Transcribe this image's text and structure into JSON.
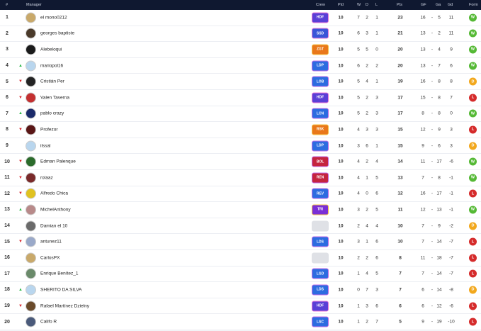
{
  "header": {
    "pos": "#",
    "manager": "Manager",
    "crew": "Crew",
    "pld": "Pld",
    "w": "W",
    "d": "D",
    "l": "L",
    "pts": "Pts",
    "gf": "GF",
    "ga": "Ga",
    "gd": "Gd",
    "form": "Form"
  },
  "colors": {
    "header_bg": "#0f1830",
    "win": "#55b935",
    "draw": "#f2a81d",
    "loss": "#d52b2b",
    "trend_up": "#2db84a",
    "trend_down": "#d8262d"
  },
  "rows": [
    {
      "pos": "1",
      "trend": "",
      "avatar": "#c9a96a",
      "name": "el mono0212",
      "crew": "HDF",
      "crew_color": "#5a3fd6",
      "crew_border": "#e97bd9",
      "pld": "10",
      "w": "7",
      "d": "2",
      "l": "1",
      "pts": "23",
      "gf": "16",
      "ga": "5",
      "gd": "11",
      "form": "W"
    },
    {
      "pos": "2",
      "trend": "",
      "avatar": "#4a3a2a",
      "name": "georges baptiste",
      "crew": "SSD",
      "crew_color": "#3a55d8",
      "crew_border": "#e97bd9",
      "pld": "10",
      "w": "6",
      "d": "3",
      "l": "1",
      "pts": "21",
      "gf": "13",
      "ga": "2",
      "gd": "11",
      "form": "W"
    },
    {
      "pos": "3",
      "trend": "",
      "avatar": "#1b1b1b",
      "name": "Alebeloqui",
      "crew": "ZGT",
      "crew_color": "#e9781a",
      "crew_border": "#f5c34a",
      "pld": "10",
      "w": "5",
      "d": "5",
      "l": "0",
      "pts": "20",
      "gf": "13",
      "ga": "4",
      "gd": "9",
      "form": "W"
    },
    {
      "pos": "4",
      "trend": "up",
      "avatar": "#b9d6ee",
      "name": "mariopol16",
      "crew": "LDP",
      "crew_color": "#2d6ce0",
      "crew_border": "#c26ce9",
      "pld": "10",
      "w": "6",
      "d": "2",
      "l": "2",
      "pts": "20",
      "gf": "13",
      "ga": "7",
      "gd": "6",
      "form": "W"
    },
    {
      "pos": "5",
      "trend": "down",
      "avatar": "#232323",
      "name": "Cristián Per",
      "crew": "LOB",
      "crew_color": "#2d6ce0",
      "crew_border": "#c26ce9",
      "pld": "10",
      "w": "5",
      "d": "4",
      "l": "1",
      "pts": "19",
      "gf": "16",
      "ga": "8",
      "gd": "8",
      "form": "D"
    },
    {
      "pos": "6",
      "trend": "down",
      "avatar": "#c43030",
      "name": "Valen Taverna",
      "crew": "HDF",
      "crew_color": "#5a3fd6",
      "crew_border": "#e97bd9",
      "pld": "10",
      "w": "5",
      "d": "2",
      "l": "3",
      "pts": "17",
      "gf": "15",
      "ga": "8",
      "gd": "7",
      "form": "L"
    },
    {
      "pos": "7",
      "trend": "up",
      "avatar": "#1a2a6a",
      "name": "pablo crazy",
      "crew": "LCN",
      "crew_color": "#2d6ce0",
      "crew_border": "#c26ce9",
      "pld": "10",
      "w": "5",
      "d": "2",
      "l": "3",
      "pts": "17",
      "gf": "8",
      "ga": "8",
      "gd": "0",
      "form": "W"
    },
    {
      "pos": "8",
      "trend": "down",
      "avatar": "#5a1616",
      "name": "Profezor",
      "crew": "RSK",
      "crew_color": "#e9781a",
      "crew_border": "#f5c34a",
      "pld": "10",
      "w": "4",
      "d": "3",
      "l": "3",
      "pts": "15",
      "gf": "12",
      "ga": "9",
      "gd": "3",
      "form": "L"
    },
    {
      "pos": "9",
      "trend": "",
      "avatar": "#b9d6ee",
      "name": "ilssal",
      "crew": "LDP",
      "crew_color": "#2d6ce0",
      "crew_border": "#c26ce9",
      "pld": "10",
      "w": "3",
      "d": "6",
      "l": "1",
      "pts": "15",
      "gf": "9",
      "ga": "6",
      "gd": "3",
      "form": "D"
    },
    {
      "pos": "10",
      "trend": "down",
      "avatar": "#2b6b2b",
      "name": "Edman Palenque",
      "crew": "BOL",
      "crew_color": "#c4243f",
      "crew_border": "#c26ce9",
      "pld": "10",
      "w": "4",
      "d": "2",
      "l": "4",
      "pts": "14",
      "gf": "11",
      "ga": "17",
      "gd": "-6",
      "form": "W"
    },
    {
      "pos": "11",
      "trend": "down",
      "avatar": "#7a2a2a",
      "name": "rolaaz",
      "crew": "REN",
      "crew_color": "#c4243f",
      "crew_border": "#c26ce9",
      "pld": "10",
      "w": "4",
      "d": "1",
      "l": "5",
      "pts": "13",
      "gf": "7",
      "ga": "8",
      "gd": "-1",
      "form": "W"
    },
    {
      "pos": "12",
      "trend": "down",
      "avatar": "#e0c220",
      "name": "Alfredo Chica",
      "crew": "REV",
      "crew_color": "#2d6ce0",
      "crew_border": "#c26ce9",
      "pld": "10",
      "w": "4",
      "d": "0",
      "l": "6",
      "pts": "12",
      "gf": "16",
      "ga": "17",
      "gd": "-1",
      "form": "L"
    },
    {
      "pos": "13",
      "trend": "up",
      "avatar": "#b88a8a",
      "name": "MichelAnthony",
      "crew": "TRI",
      "crew_color": "#7a2fd6",
      "crew_border": "#f5c34a",
      "pld": "10",
      "w": "3",
      "d": "2",
      "l": "5",
      "pts": "11",
      "gf": "12",
      "ga": "13",
      "gd": "-1",
      "form": "W"
    },
    {
      "pos": "14",
      "trend": "",
      "avatar": "#6a6a6a",
      "name": "Damian el 10",
      "crew": "",
      "crew_color": "",
      "crew_border": "",
      "pld": "10",
      "w": "2",
      "d": "4",
      "l": "4",
      "pts": "10",
      "gf": "7",
      "ga": "9",
      "gd": "-2",
      "form": "D"
    },
    {
      "pos": "15",
      "trend": "down",
      "avatar": "#9aa9c9",
      "name": "antunez11",
      "crew": "LDS",
      "crew_color": "#2d6ce0",
      "crew_border": "#c26ce9",
      "pld": "10",
      "w": "3",
      "d": "1",
      "l": "6",
      "pts": "10",
      "gf": "7",
      "ga": "14",
      "gd": "-7",
      "form": "L"
    },
    {
      "pos": "16",
      "trend": "",
      "avatar": "#c9a96a",
      "name": "CarlosPX",
      "crew": "",
      "crew_color": "",
      "crew_border": "",
      "pld": "10",
      "w": "2",
      "d": "2",
      "l": "6",
      "pts": "8",
      "gf": "11",
      "ga": "18",
      "gd": "-7",
      "form": "L"
    },
    {
      "pos": "17",
      "trend": "",
      "avatar": "#6a8a6a",
      "name": "Enrique Benítez_1",
      "crew": "LGD",
      "crew_color": "#2d6ce0",
      "crew_border": "#c26ce9",
      "pld": "10",
      "w": "1",
      "d": "4",
      "l": "5",
      "pts": "7",
      "gf": "7",
      "ga": "14",
      "gd": "-7",
      "form": "L"
    },
    {
      "pos": "18",
      "trend": "up",
      "avatar": "#b9d6ee",
      "name": "SHERITO DA SILVA",
      "crew": "LDS",
      "crew_color": "#2d6ce0",
      "crew_border": "#c26ce9",
      "pld": "10",
      "w": "0",
      "d": "7",
      "l": "3",
      "pts": "7",
      "gf": "6",
      "ga": "14",
      "gd": "-8",
      "form": "D"
    },
    {
      "pos": "19",
      "trend": "down",
      "avatar": "#6a4a2a",
      "name": "Rafael Martínez Dzielny",
      "crew": "HDF",
      "crew_color": "#5a3fd6",
      "crew_border": "#e97bd9",
      "pld": "10",
      "w": "1",
      "d": "3",
      "l": "6",
      "pts": "6",
      "gf": "6",
      "ga": "12",
      "gd": "-6",
      "form": "L"
    },
    {
      "pos": "20",
      "trend": "",
      "avatar": "#4a5a7a",
      "name": "Califo R",
      "crew": "LSC",
      "crew_color": "#2d6ce0",
      "crew_border": "#c26ce9",
      "pld": "10",
      "w": "1",
      "d": "2",
      "l": "7",
      "pts": "5",
      "gf": "9",
      "ga": "19",
      "gd": "-10",
      "form": "L"
    }
  ]
}
